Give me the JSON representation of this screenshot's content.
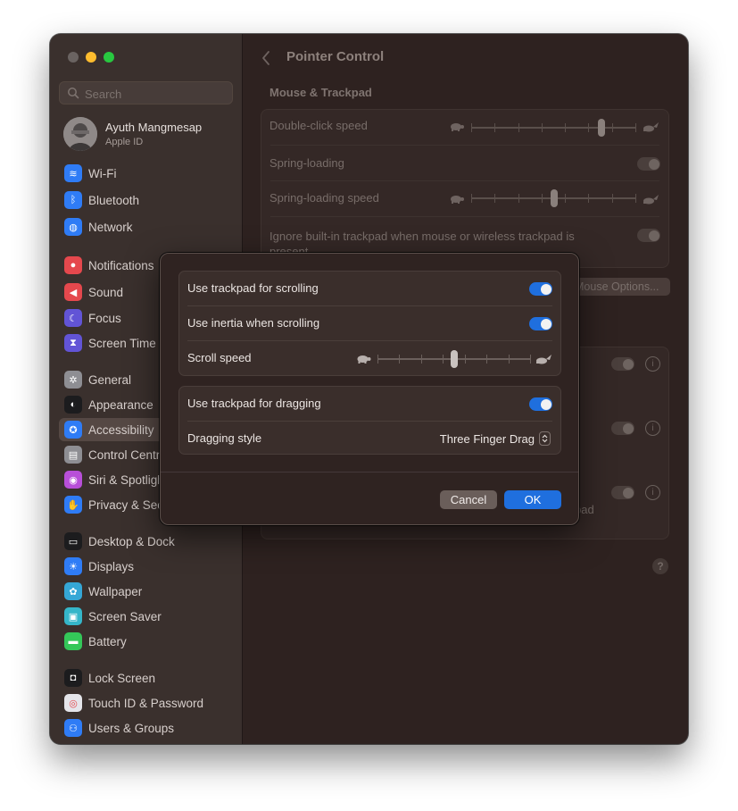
{
  "window": {
    "title": "Pointer Control"
  },
  "sidebar": {
    "search_placeholder": "Search",
    "account": {
      "name": "Ayuth Mangmesap",
      "subtitle": "Apple ID"
    },
    "items": [
      {
        "label": "Wi-Fi",
        "icon": "wifi-icon",
        "color": "#2f7cf6"
      },
      {
        "label": "Bluetooth",
        "icon": "bluetooth-icon",
        "color": "#2f7cf6"
      },
      {
        "label": "Network",
        "icon": "globe-icon",
        "color": "#2f7cf6"
      },
      {
        "label": "Notifications",
        "icon": "bell-icon",
        "color": "#e5484d"
      },
      {
        "label": "Sound",
        "icon": "speaker-icon",
        "color": "#e5484d"
      },
      {
        "label": "Focus",
        "icon": "moon-icon",
        "color": "#6254d6"
      },
      {
        "label": "Screen Time",
        "icon": "hourglass-icon",
        "color": "#6254d6"
      },
      {
        "label": "General",
        "icon": "gear-icon",
        "color": "#8e8e93"
      },
      {
        "label": "Appearance",
        "icon": "appearance-icon",
        "color": "#1c1c1e"
      },
      {
        "label": "Accessibility",
        "icon": "accessibility-icon",
        "color": "#2f7cf6"
      },
      {
        "label": "Control Centre",
        "icon": "control-centre-icon",
        "color": "#8e8e93"
      },
      {
        "label": "Siri & Spotlight",
        "icon": "siri-icon",
        "color": "#b84fd8"
      },
      {
        "label": "Privacy & Security",
        "icon": "hand-icon",
        "color": "#2f7cf6"
      },
      {
        "label": "Desktop & Dock",
        "icon": "dock-icon",
        "color": "#1c1c1e"
      },
      {
        "label": "Displays",
        "icon": "sun-icon",
        "color": "#2f7cf6"
      },
      {
        "label": "Wallpaper",
        "icon": "flower-icon",
        "color": "#35a7d6"
      },
      {
        "label": "Screen Saver",
        "icon": "screensaver-icon",
        "color": "#35b6c9"
      },
      {
        "label": "Battery",
        "icon": "battery-icon",
        "color": "#34c759"
      },
      {
        "label": "Lock Screen",
        "icon": "lock-icon",
        "color": "#1c1c1e"
      },
      {
        "label": "Touch ID & Password",
        "icon": "fingerprint-icon",
        "color": "#e5e5ea"
      },
      {
        "label": "Users & Groups",
        "icon": "users-icon",
        "color": "#2f7cf6"
      }
    ],
    "active_item": "Accessibility"
  },
  "main": {
    "section_title": "Mouse & Trackpad",
    "rows": {
      "double_click": "Double-click speed",
      "spring_loading": "Spring-loading",
      "spring_loading_speed": "Spring-loading speed",
      "ignore_trackpad": "Ignore built-in trackpad when mouse or wireless trackpad is present"
    },
    "mouse_options_button": "Mouse Options...",
    "trackpad_options_fragment": "pad",
    "help_label": "?",
    "double_click_level": 0.8,
    "spring_loading_speed_level": 0.5
  },
  "modal": {
    "rows": {
      "scrolling": "Use trackpad for scrolling",
      "inertia": "Use inertia when scrolling",
      "scroll_speed": "Scroll speed",
      "dragging": "Use trackpad for dragging",
      "dragging_style": "Dragging style"
    },
    "dragging_style_value": "Three Finger Drag",
    "scroll_speed_level": 0.5,
    "toggles": {
      "scrolling": true,
      "inertia": true,
      "dragging": true
    },
    "buttons": {
      "cancel": "Cancel",
      "ok": "OK"
    }
  },
  "colors": {
    "accent": "#1f6fde",
    "close": "#6a6361",
    "minimize": "#febc2e",
    "zoom": "#28c840"
  }
}
